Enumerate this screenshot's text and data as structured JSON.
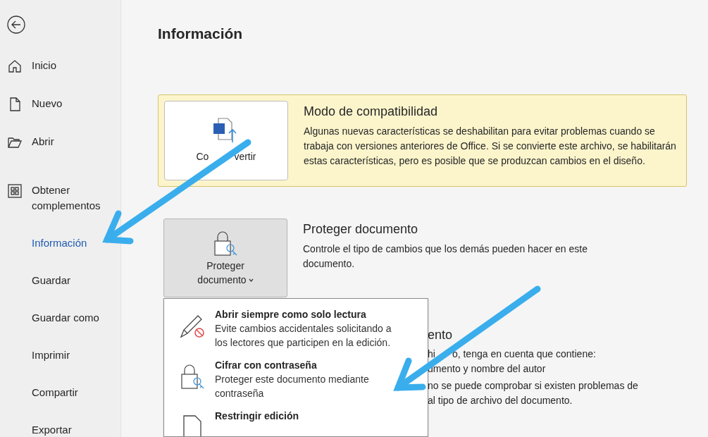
{
  "sidebar": {
    "top_items": [
      {
        "label": "Inicio",
        "selected": false
      },
      {
        "label": "Nuevo",
        "selected": false
      },
      {
        "label": "Abrir",
        "selected": false
      }
    ],
    "items": [
      {
        "label": "Obtener complementos",
        "selected": false
      },
      {
        "label": "Información",
        "selected": true
      },
      {
        "label": "Guardar",
        "selected": false
      },
      {
        "label": "Guardar como",
        "selected": false
      },
      {
        "label": "Imprimir",
        "selected": false
      },
      {
        "label": "Compartir",
        "selected": false
      },
      {
        "label": "Exportar",
        "selected": false
      }
    ]
  },
  "page_title": "Información",
  "compatibility": {
    "button": [
      "Co",
      "vertir"
    ],
    "title": "Modo de compatibilidad",
    "text": "Algunas nuevas características se deshabilitan para evitar problemas cuando se trabaja con versiones anteriores de Office. Si se convierte este archivo, se habilitarán estas características, pero es posible que se produzcan cambios en el diseño."
  },
  "protect": {
    "button": "Proteger documento",
    "expanded": true,
    "title": "Proteger documento",
    "text": "Controle el tipo de cambios que los demás pueden hacer en este documento."
  },
  "protect_menu": [
    {
      "title": "Abrir siempre como solo lectura",
      "text": "Evite cambios accidentales solicitando a los lectores que participen en la edición."
    },
    {
      "title": "Cifrar con contraseña",
      "text": "Proteger este documento mediante contraseña"
    },
    {
      "title": "Restringir edición"
    }
  ],
  "inspect": {
    "title": "ento",
    "lines": [
      [
        "hi",
        "o, tenga en cuenta que contiene:"
      ],
      [
        "umento y nombre del autor"
      ],
      [
        "no se puede comprobar si existen problemas de"
      ],
      [
        "al tipo de archivo del documento."
      ]
    ]
  }
}
